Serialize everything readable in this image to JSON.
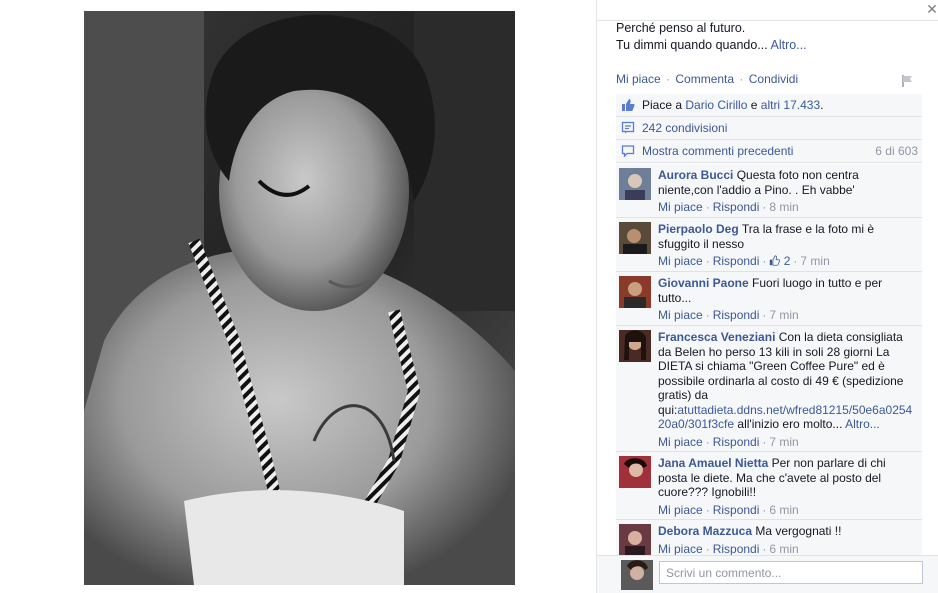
{
  "caption": {
    "line1": "Perché penso al futuro.",
    "line2": "Tu dimmi quando quando...",
    "more": "Altro..."
  },
  "actions": {
    "like": "Mi piace",
    "comment": "Commenta",
    "share": "Condividi",
    "separator": "·"
  },
  "likes": {
    "prefix": "Piace a",
    "name": "Dario Cirillo",
    "conj": "e",
    "others": "altri 17.433",
    "suffix": "."
  },
  "shares": {
    "label": "242 condivisioni"
  },
  "previous": {
    "label": "Mostra commenti precedenti",
    "count": "6 di 603"
  },
  "comments": [
    {
      "author": "Aurora Bucci",
      "text": "Questa foto non centra niente,con l'addio a Pino. . Eh vabbe'",
      "like": "Mi piace",
      "reply": "Rispondi",
      "time": "8 min",
      "avatar_color": "#6f7f9a"
    },
    {
      "author": "Pierpaolo Deg",
      "text": "Tra la frase e la foto mi è sfuggito il nesso",
      "like": "Mi piace",
      "reply": "Rispondi",
      "likes_count": "2",
      "time": "7 min",
      "avatar_color": "#5a4a3a"
    },
    {
      "author": "Giovanni Paone",
      "text": "Fuori luogo in tutto e per tutto...",
      "like": "Mi piace",
      "reply": "Rispondi",
      "time": "7 min",
      "avatar_color": "#8a3a2a"
    },
    {
      "author": "Francesca Veneziani",
      "text_pre": "Con la dieta consigliata da Belen ho perso 13 kili in soli 28 giorni La DIETA si chiama \"Green Coffee Pure\" ed è possibile ordinarla al costo di 49 € (spedizione gratis) da qui:",
      "text_link": "atuttadieta.ddns.net/wfred81215/50e6a0254 20a0/301f3cfe",
      "text_post": " all'inizio ero molto...",
      "more": "Altro...",
      "like": "Mi piace",
      "reply": "Rispondi",
      "time": "7 min",
      "avatar_color": "#4a2a22"
    },
    {
      "author": "Jana Amauel Nietta",
      "text": "Per non parlare di chi posta le diete. Ma che c'avete al posto del cuore??? Ignobili!!",
      "like": "Mi piace",
      "reply": "Rispondi",
      "time": "6 min",
      "avatar_color": "#a0303a"
    },
    {
      "author": "Debora Mazzuca",
      "text": "Ma vergognati !!",
      "like": "Mi piace",
      "reply": "Rispondi",
      "time": "6 min",
      "avatar_color": "#6a3a44"
    }
  ],
  "composer": {
    "placeholder": "Scrivi un commento..."
  },
  "colors": {
    "link": "#3b5998",
    "meta": "#9197a3",
    "ufi_bg": "#f6f7f9",
    "border": "#e1e2e3"
  },
  "icons": {
    "close": "close-icon",
    "flag": "flag-icon",
    "like": "thumbs-up-icon",
    "share": "share-icon",
    "comment": "comment-bubble-icon"
  }
}
